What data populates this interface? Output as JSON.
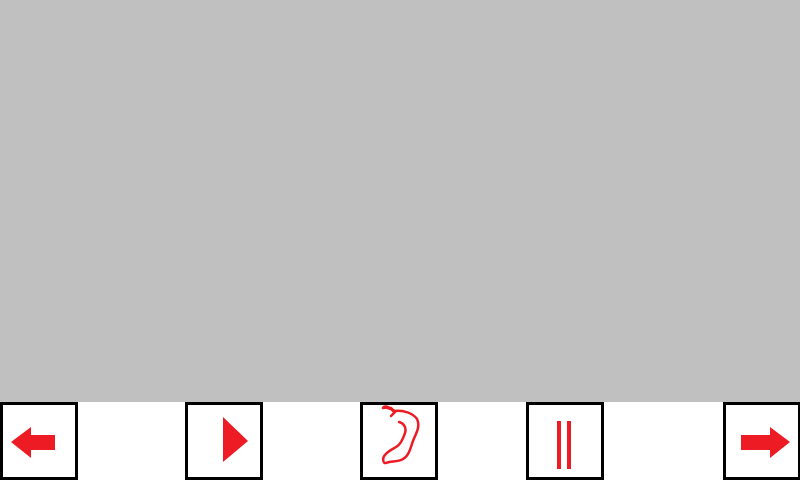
{
  "colors": {
    "display_background": "#c0c0c0",
    "control_background": "#ffffff",
    "button_border": "#000000",
    "icon_color": "#ed1c24"
  },
  "controls": [
    {
      "name": "previous-button",
      "icon": "arrow-left-icon"
    },
    {
      "name": "play-button",
      "icon": "play-icon"
    },
    {
      "name": "replay-button",
      "icon": "replay-icon"
    },
    {
      "name": "pause-button",
      "icon": "pause-icon"
    },
    {
      "name": "next-button",
      "icon": "arrow-right-icon"
    }
  ]
}
